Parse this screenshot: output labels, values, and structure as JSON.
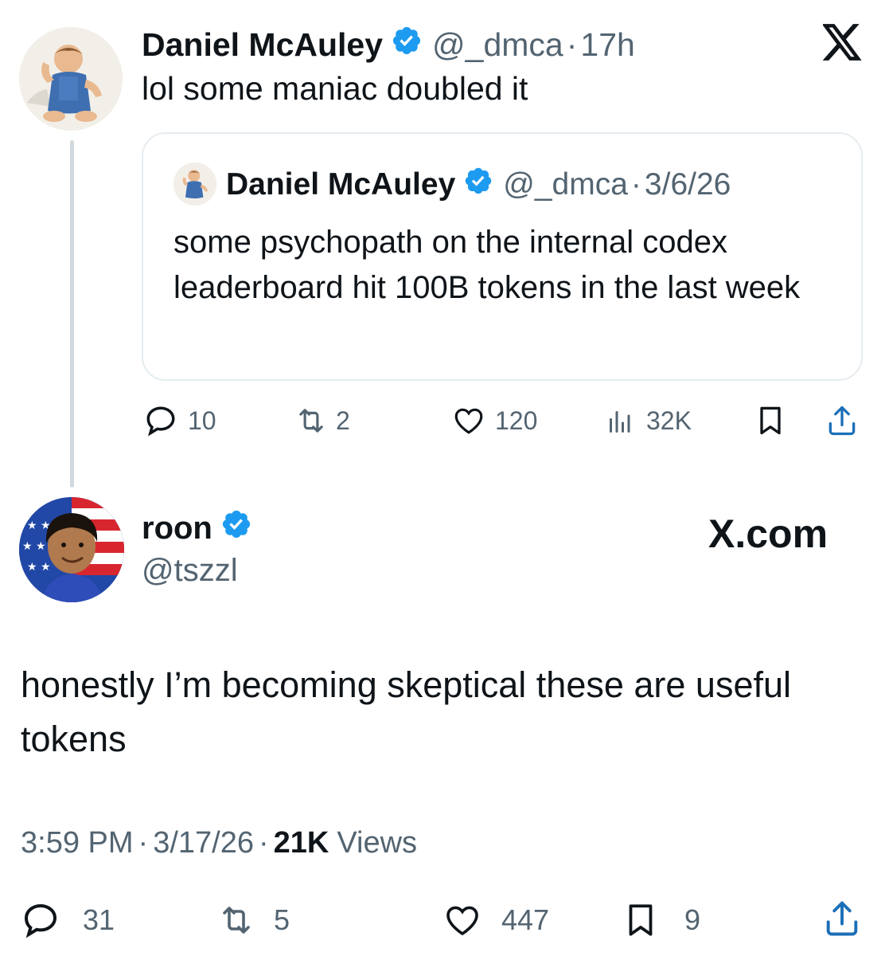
{
  "reply_tweet": {
    "author_name": "Daniel McAuley",
    "handle": "@_dmca",
    "separator": "·",
    "time": "17h",
    "text": "lol some maniac doubled it",
    "quote": {
      "author_name": "Daniel McAuley",
      "handle": "@_dmca",
      "separator": "·",
      "date": "3/6/26",
      "text": "some psychopath on the internal codex leaderboard hit 100B tokens in the last week"
    },
    "actions": {
      "replies": "10",
      "reposts": "2",
      "likes": "120",
      "views": "32K"
    }
  },
  "main_tweet": {
    "author_name": "roon",
    "handle": "@tszzl",
    "brand": "X.com",
    "text": "honestly I’m becoming skeptical these are useful tokens",
    "meta": {
      "time": "3:59 PM",
      "sep1": "·",
      "date": "3/17/26",
      "sep2": "·",
      "views_count": "21K",
      "views_label": "Views"
    },
    "actions": {
      "replies": "31",
      "reposts": "5",
      "likes": "447",
      "bookmarks": "9"
    }
  },
  "colors": {
    "verified": "#1d9bf0",
    "text": "#0f1419",
    "secondary": "#536471",
    "border": "#e6ecf0"
  },
  "icons": [
    "x-logo-icon",
    "verified-badge-icon",
    "reply-icon",
    "repost-icon",
    "like-icon",
    "views-icon",
    "bookmark-icon",
    "share-icon"
  ]
}
